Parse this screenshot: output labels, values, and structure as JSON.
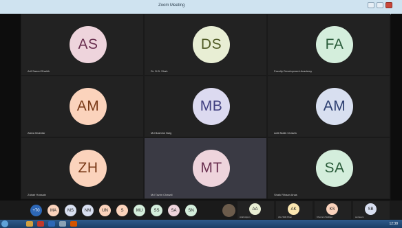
{
  "window": {
    "title": "Zoom Meeting",
    "close_label": "✕"
  },
  "tiles": [
    {
      "initials": "AS",
      "name": "Arif Saeed Shaikh",
      "color": "#eed4dc",
      "text": "#6a3050"
    },
    {
      "initials": "DS",
      "name": "Dr. D.B. Shah",
      "color": "#e8eed4",
      "text": "#4f5a24"
    },
    {
      "initials": "FA",
      "name": "Faculty Development Academy",
      "color": "#d4eedc",
      "text": "#2a5c3a"
    },
    {
      "initials": "AM",
      "name": "Aisha Mukhtar",
      "color": "#fbd3bc",
      "text": "#7a3a18"
    },
    {
      "initials": "MB",
      "name": "Md Bashirul Baig",
      "color": "#dcdaf0",
      "text": "#414080"
    },
    {
      "initials": "AM",
      "name": "Aditi Malik Chawla",
      "color": "#d8dff0",
      "text": "#2c3e70"
    },
    {
      "initials": "ZH",
      "name": "Zubair Hussain",
      "color": "#fbd3bc",
      "text": "#7a3a18"
    },
    {
      "initials": "MT",
      "name": "Md Tazim Chawdi",
      "color": "#eed4dc",
      "text": "#6a3050"
    },
    {
      "initials": "SA",
      "name": "Shaik Rihaan Anas",
      "color": "#d4eedc",
      "text": "#2a5c3a"
    }
  ],
  "strip": {
    "more": "+70",
    "chips": [
      {
        "initials": "MA",
        "color": "#fbd3bc"
      },
      {
        "initials": "MS",
        "color": "#d8dff0"
      },
      {
        "initials": "NM",
        "color": "#d8dff0"
      },
      {
        "initials": "UN",
        "color": "#fbd3bc"
      },
      {
        "initials": "S",
        "color": "#fbd3bc"
      },
      {
        "initials": "MU",
        "color": "#d4eedc"
      },
      {
        "initials": "SS",
        "color": "#d4eedc"
      },
      {
        "initials": "SA",
        "color": "#eed4dc"
      },
      {
        "initials": "SN",
        "color": "#d4eedc"
      }
    ],
    "small_tiles": [
      {
        "initials": "AA",
        "color": "#e8eed4",
        "name": "Arab Anjum"
      },
      {
        "initials": "AK",
        "color": "#fbe6b0",
        "name": "Abu Talib Khan"
      },
      {
        "initials": "KS",
        "color": "#fbd3bc",
        "name": "Khurram Siddiqui"
      },
      {
        "initials": "SB",
        "color": "#d8dff0",
        "name": "sunbeam"
      }
    ]
  },
  "taskbar": {
    "clock": "12:38"
  }
}
